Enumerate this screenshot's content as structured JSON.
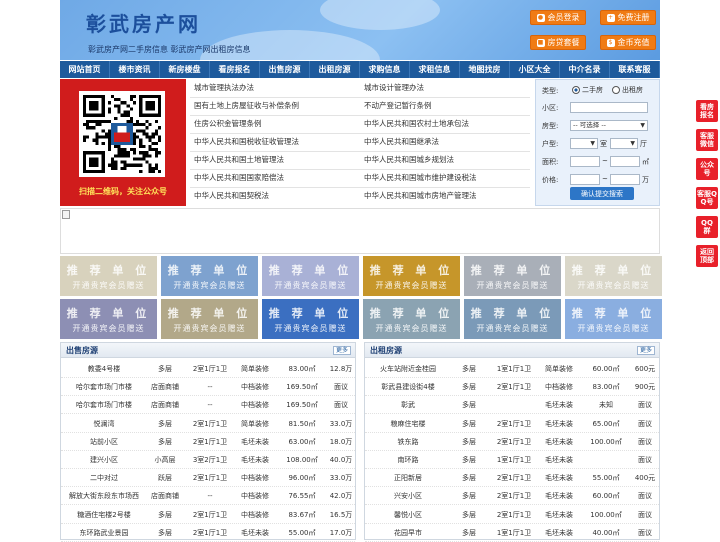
{
  "header": {
    "title": "彰武房产网",
    "subtitle": "彰武房产网二手房信息    彰武房产网出租房信息",
    "buttons": [
      {
        "label": "会员登录",
        "icon": "user-icon"
      },
      {
        "label": "免费注册",
        "icon": "register-icon"
      },
      {
        "label": "房贷套餐",
        "icon": "package-icon"
      },
      {
        "label": "金币充值",
        "icon": "coin-icon"
      }
    ]
  },
  "nav": [
    "网站首页",
    "楼市资讯",
    "新房楼盘",
    "看房报名",
    "出售房源",
    "出租房源",
    "求购信息",
    "求租信息",
    "地图找房",
    "小区大全",
    "中介名录",
    "联系客服"
  ],
  "qr": {
    "caption": "扫描二维码，关注公众号"
  },
  "laws": {
    "left": [
      "城市管理执法办法",
      "国有土地上房屋征收与补偿条例",
      "住房公积金管理条例",
      "中华人民共和国税收征收管理法",
      "中华人民共和国土地管理法",
      "中华人民共和国国家赔偿法",
      "中华人民共和国契税法"
    ],
    "right": [
      "城市设计管理办法",
      "不动产登记暂行条例",
      "中华人民共和国农村土地承包法",
      "中华人民共和国继承法",
      "中华人民共和国城乡规划法",
      "中华人民共和国城市维护建设税法",
      "中华人民共和国城市房地产管理法"
    ]
  },
  "search": {
    "type_label": "类型:",
    "type_options": [
      "二手房",
      "出租房"
    ],
    "type_selected": "二手房",
    "community_label": "小区:",
    "community_value": "",
    "house_type_label": "房型:",
    "house_type_value": "-- 可选择 --",
    "layout_label": "户型:",
    "shi": "室",
    "ting": "厅",
    "area_label": "面积:",
    "area_unit": "㎡",
    "price_label": "价格:",
    "price_unit": "万",
    "tilde": "~",
    "submit": "确认提交搜索"
  },
  "promo": {
    "title": "推 荐 单 位",
    "subtitle": "开通贵宾会员赠送",
    "colors": [
      "#d8d2bd",
      "#7ea2cf",
      "#a9b1d6",
      "#c6962a",
      "#a9afb8",
      "#dad7c9",
      "#8d8fb4",
      "#b2a889",
      "#3b6fc1",
      "#8ba3b2",
      "#7b9ab8",
      "#8aaee0"
    ]
  },
  "sale": {
    "title": "出售房源",
    "more": "更多",
    "rows": [
      [
        "教委4号楼",
        "多层",
        "2室1厅1卫",
        "简单装修",
        "83.00㎡",
        "12.8万"
      ],
      [
        "哈尔套市场门市楼",
        "店面商铺",
        "--",
        "中档装修",
        "169.50㎡",
        "面议"
      ],
      [
        "哈尔套市场门市楼",
        "店面商铺",
        "--",
        "中档装修",
        "169.50㎡",
        "面议"
      ],
      [
        "悦澜湾",
        "多层",
        "2室1厅1卫",
        "简单装修",
        "81.50㎡",
        "33.0万"
      ],
      [
        "站前小区",
        "多层",
        "2室1厅1卫",
        "毛坯未装",
        "63.00㎡",
        "18.0万"
      ],
      [
        "建兴小区",
        "小高层",
        "3室2厅1卫",
        "毛坯未装",
        "108.00㎡",
        "40.0万"
      ],
      [
        "二中对过",
        "跃层",
        "2室1厅1卫",
        "中档装修",
        "96.00㎡",
        "33.0万"
      ],
      [
        "解放大街东段东市场西",
        "店面商铺",
        "--",
        "中档装修",
        "76.55㎡",
        "42.0万"
      ],
      [
        "糖酒住宅楼2号楼",
        "多层",
        "2室1厅1卫",
        "中档装修",
        "83.67㎡",
        "16.5万"
      ],
      [
        "东环路武业景园",
        "多层",
        "2室1厅1卫",
        "毛坯未装",
        "55.00㎡",
        "17.0万"
      ]
    ]
  },
  "rent": {
    "title": "出租房源",
    "more": "更多",
    "rows": [
      [
        "火车站附近金桂园",
        "多层",
        "1室1厅1卫",
        "简单装修",
        "60.00㎡",
        "600元"
      ],
      [
        "彰武县建设街4楼",
        "多层",
        "2室1厅1卫",
        "中档装修",
        "83.00㎡",
        "900元"
      ],
      [
        "彰武",
        "多层",
        "",
        "毛坯未装",
        "未知",
        "面议"
      ],
      [
        "粮麻住宅楼",
        "多层",
        "2室1厅1卫",
        "毛坯未装",
        "65.00㎡",
        "面议"
      ],
      [
        "铁东路",
        "多层",
        "2室1厅1卫",
        "毛坯未装",
        "100.00㎡",
        "面议"
      ],
      [
        "南环路",
        "多层",
        "1室1厅1卫",
        "毛坯未装",
        "",
        "面议"
      ],
      [
        "正阳新居",
        "多层",
        "2室1厅1卫",
        "毛坯未装",
        "55.00㎡",
        "400元"
      ],
      [
        "兴安小区",
        "多层",
        "2室1厅1卫",
        "毛坯未装",
        "60.00㎡",
        "面议"
      ],
      [
        "馨悦小区",
        "多层",
        "2室1厅1卫",
        "毛坯未装",
        "100.00㎡",
        "面议"
      ],
      [
        "花园早市",
        "多层",
        "1室1厅1卫",
        "毛坯未装",
        "40.00㎡",
        "面议"
      ]
    ]
  },
  "side_buttons": [
    "看房报名",
    "客服微信",
    "公众号",
    "客服QQ号",
    "QQ群",
    "返回顶部"
  ]
}
